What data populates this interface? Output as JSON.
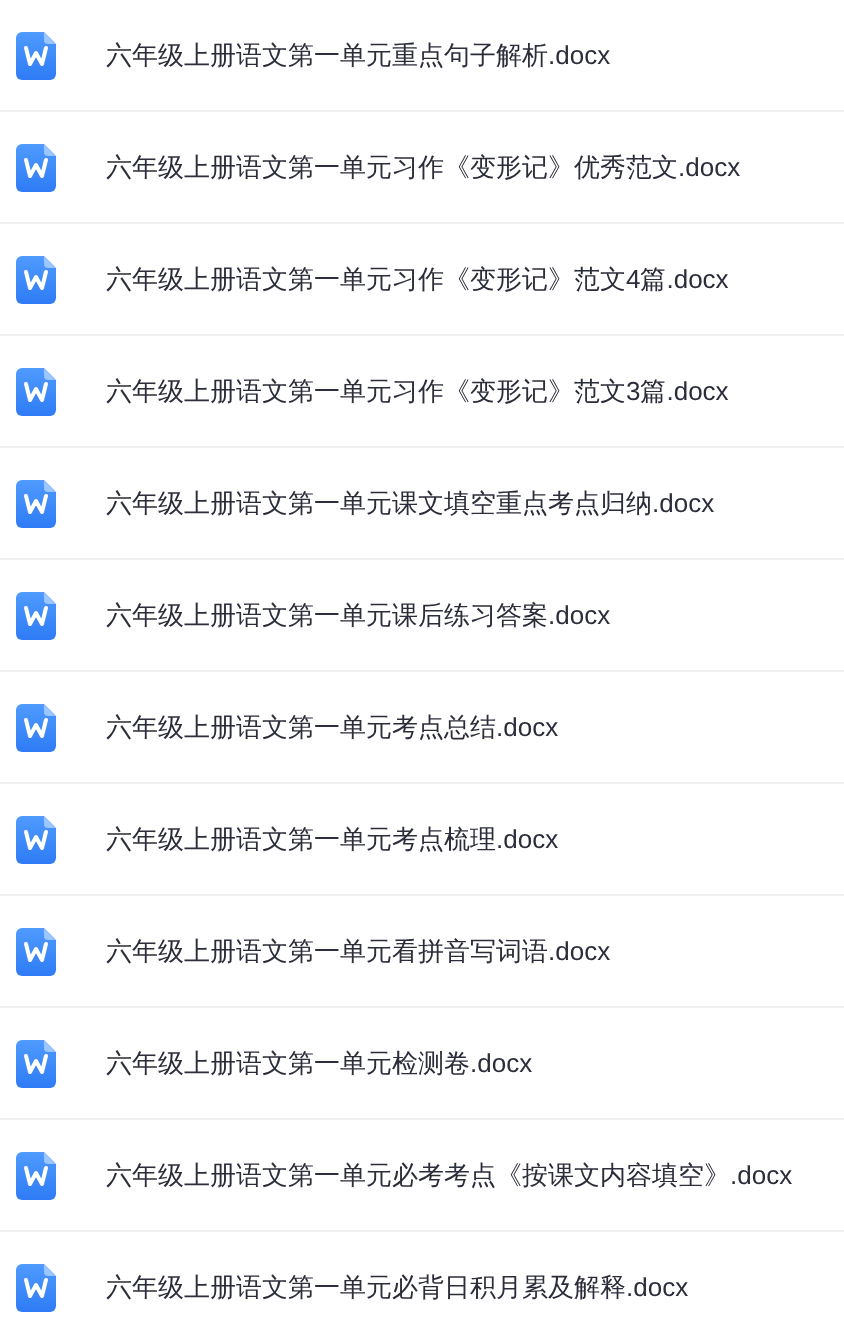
{
  "files": [
    {
      "name": "六年级上册语文第一单元重点句子解析.docx",
      "kind": "word"
    },
    {
      "name": "六年级上册语文第一单元习作《变形记》优秀范文.docx",
      "kind": "word"
    },
    {
      "name": "六年级上册语文第一单元习作《变形记》范文4篇.docx",
      "kind": "word"
    },
    {
      "name": "六年级上册语文第一单元习作《变形记》范文3篇.docx",
      "kind": "word"
    },
    {
      "name": "六年级上册语文第一单元课文填空重点考点归纳.docx",
      "kind": "word"
    },
    {
      "name": "六年级上册语文第一单元课后练习答案.docx",
      "kind": "word"
    },
    {
      "name": "六年级上册语文第一单元考点总结.docx",
      "kind": "word"
    },
    {
      "name": "六年级上册语文第一单元考点梳理.docx",
      "kind": "word"
    },
    {
      "name": "六年级上册语文第一单元看拼音写词语.docx",
      "kind": "word"
    },
    {
      "name": "六年级上册语文第一单元检测卷.docx",
      "kind": "word"
    },
    {
      "name": "六年级上册语文第一单元必考考点《按课文内容填空》.docx",
      "kind": "word"
    },
    {
      "name": "六年级上册语文第一单元必背日积月累及解释.docx",
      "kind": "word"
    }
  ]
}
